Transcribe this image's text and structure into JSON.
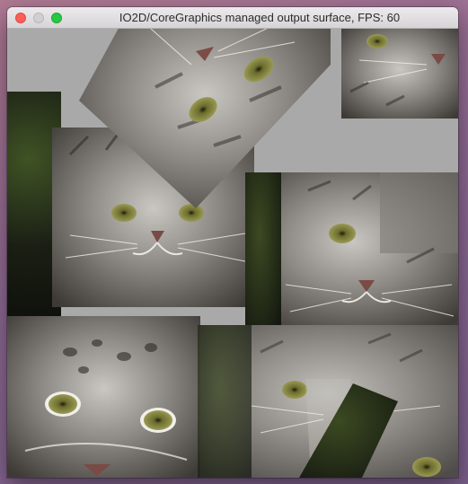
{
  "window": {
    "title": "IO2D/CoreGraphics managed output surface, FPS: 60"
  },
  "surface": {
    "background_color": "#a9a9a9",
    "image_subject": "pallas-cat",
    "tiles": [
      {
        "name": "tile-dark-left-column",
        "kind": "dark"
      },
      {
        "name": "tile-cat-face-upper-left",
        "kind": "face-straight"
      },
      {
        "name": "tile-cat-face-rotated-top",
        "kind": "face-rotated"
      },
      {
        "name": "tile-cat-face-top-right",
        "kind": "face-straight"
      },
      {
        "name": "tile-cat-face-middle-right",
        "kind": "face-straight"
      },
      {
        "name": "tile-cat-eyes-bottom-left",
        "kind": "face-closeup"
      },
      {
        "name": "tile-cat-face-bottom-right",
        "kind": "face-faded"
      },
      {
        "name": "tile-dark-bottom-wedge",
        "kind": "dark"
      }
    ]
  }
}
